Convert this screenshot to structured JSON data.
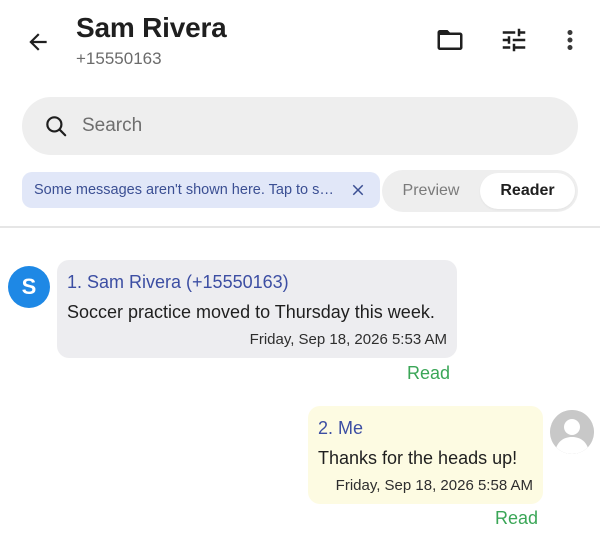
{
  "header": {
    "contact_name": "Sam Rivera",
    "contact_number": "+15550163",
    "icons": [
      "arrow-back-icon",
      "folder-icon",
      "tune-icon",
      "more-vert-icon"
    ]
  },
  "search": {
    "placeholder": "Search"
  },
  "banner": {
    "text": "Some messages aren't shown here. Tap to see them."
  },
  "view_toggle": {
    "options": [
      "Preview",
      "Reader"
    ],
    "selected": "Reader"
  },
  "messages": [
    {
      "sender": "1. Sam Rivera (+15550163)",
      "avatar_letter": "S",
      "text": "Soccer practice moved to Thursday this week.",
      "timestamp": "Friday, Sep 18, 2026 5:53 AM",
      "status": "Read",
      "direction": "incoming"
    },
    {
      "sender": "2. Me",
      "text": "Thanks for the heads up!",
      "timestamp": "Friday, Sep 18, 2026 5:58 AM",
      "status": "Read",
      "direction": "outgoing"
    }
  ],
  "colors": {
    "sender_name": "#3c4ea3",
    "read_status": "#3aa657",
    "avatar_bg": "#1e88e5",
    "incoming_bubble": "#ededf0",
    "outgoing_bubble": "#fdfbe2",
    "banner_bg": "#e1e7f8",
    "banner_text": "#3b4f93"
  }
}
